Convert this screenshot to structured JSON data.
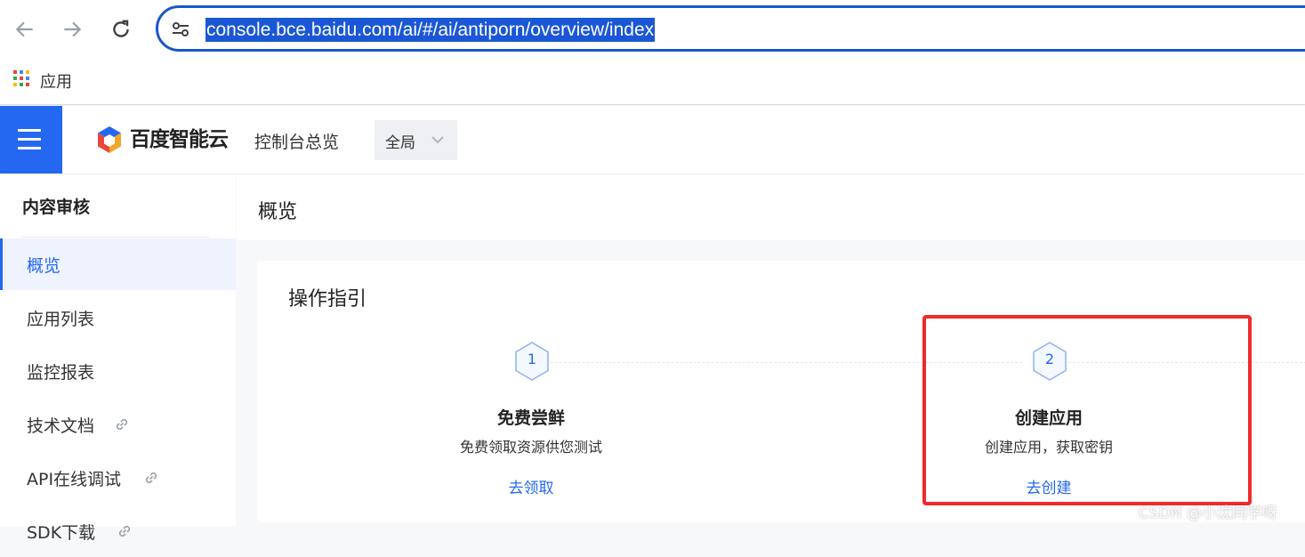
{
  "browser": {
    "url": "console.bce.baidu.com/ai/#/ai/antiporn/overview/index",
    "bookmark_apps_label": "应用"
  },
  "header": {
    "brand": "百度智能云",
    "console_overview": "控制台总览",
    "region": "全局"
  },
  "sidebar": {
    "title": "内容审核",
    "items": [
      {
        "label": "概览",
        "active": true
      },
      {
        "label": "应用列表"
      },
      {
        "label": "监控报表"
      },
      {
        "label": "技术文档",
        "external_icon": "link-icon"
      },
      {
        "label": "API在线调试",
        "external_icon": "link-icon"
      },
      {
        "label": "SDK下载",
        "external_icon": "link-icon"
      }
    ]
  },
  "main": {
    "page_title": "概览",
    "guide": {
      "title": "操作指引",
      "steps": [
        {
          "number": "1",
          "title": "免费尝鲜",
          "desc": "免费领取资源供您测试",
          "link": "去领取"
        },
        {
          "number": "2",
          "title": "创建应用",
          "desc": "创建应用，获取密钥",
          "link": "去创建"
        }
      ]
    }
  },
  "watermark": "CSDN @小沈同学呀",
  "colors": {
    "accent": "#2468f2",
    "highlight": "#f02b2b",
    "url_selection": "#1a57d6"
  }
}
